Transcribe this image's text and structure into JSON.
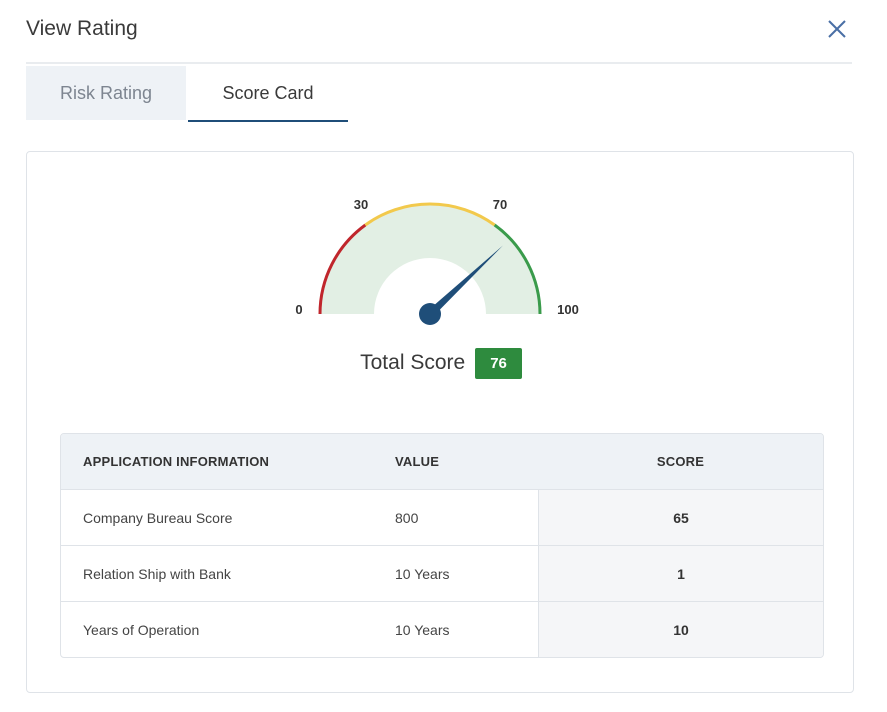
{
  "modal": {
    "title": "View Rating",
    "close_icon": "close-icon"
  },
  "tabs": [
    {
      "label": "Risk Rating",
      "active": false
    },
    {
      "label": "Score Card",
      "active": true
    }
  ],
  "gauge": {
    "min_label": "0",
    "low_label": "30",
    "high_label": "70",
    "max_label": "100",
    "value": 76,
    "colors": {
      "low": "#c0262c",
      "mid": "#f2c94c",
      "high": "#3a9b4b",
      "fill": "#e2efe4",
      "needle": "#1f4e79"
    }
  },
  "total": {
    "label": "Total Score",
    "value": "76",
    "badge_color": "#2e8b3e"
  },
  "table": {
    "headers": [
      "APPLICATION INFORMATION",
      "VALUE",
      "SCORE"
    ],
    "rows": [
      {
        "info": "Company Bureau Score",
        "value": "800",
        "score": "65"
      },
      {
        "info": "Relation Ship with Bank",
        "value": "10 Years",
        "score": "1"
      },
      {
        "info": "Years of Operation",
        "value": "10 Years",
        "score": "10"
      }
    ]
  }
}
